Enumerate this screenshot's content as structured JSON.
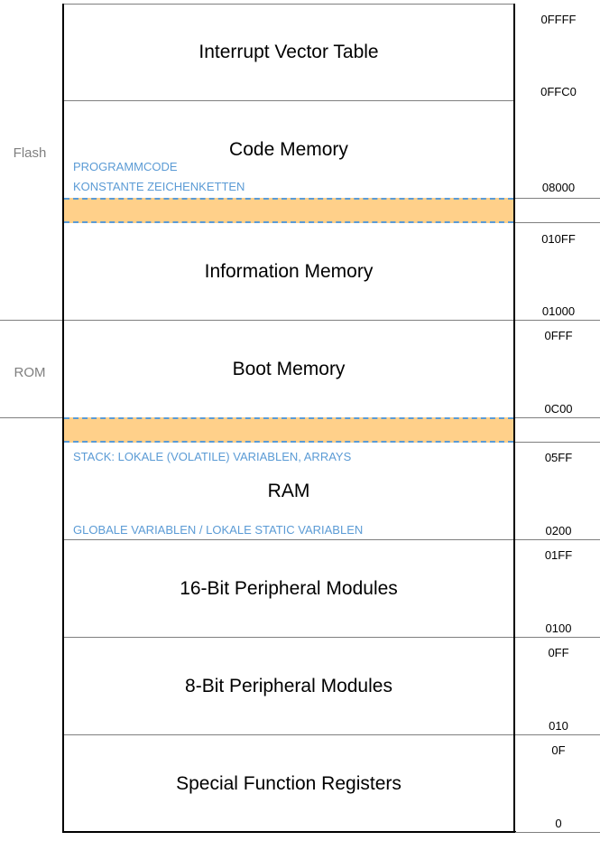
{
  "regions": {
    "flash": "Flash",
    "rom": "ROM"
  },
  "segments": {
    "ivt": "Interrupt Vector Table",
    "code": "Code Memory",
    "info": "Information Memory",
    "boot": "Boot Memory",
    "ram": "RAM",
    "p16": "16-Bit Peripheral  Modules",
    "p8": "8-Bit Peripheral  Modules",
    "sfr": "Special Function Registers"
  },
  "notes": {
    "programmcode": "PROGRAMMCODE",
    "konstante": "KONSTANTE ZEICHENKETTEN",
    "stack": "STACK: LOKALE (VOLATILE) VARIABLEN, ARRAYS",
    "globale": "GLOBALE VARIABLEN / LOKALE STATIC VARIABLEN"
  },
  "addresses": {
    "a0FFFF": "0FFFF",
    "a0FFC0": "0FFC0",
    "a08000": "08000",
    "a010FF": "010FF",
    "a01000": "01000",
    "a0FFF": "0FFF",
    "a0C00": "0C00",
    "a05FF": "05FF",
    "a0200": "0200",
    "a01FF": "01FF",
    "a0100": "0100",
    "a0FF": "0FF",
    "a010": "010",
    "a0F": "0F",
    "a0": "0"
  },
  "colors": {
    "note_text": "#5b9bd5",
    "band_fill": "#ffd08a",
    "band_border": "#5b9bd5",
    "divider": "#7f7f7f"
  }
}
